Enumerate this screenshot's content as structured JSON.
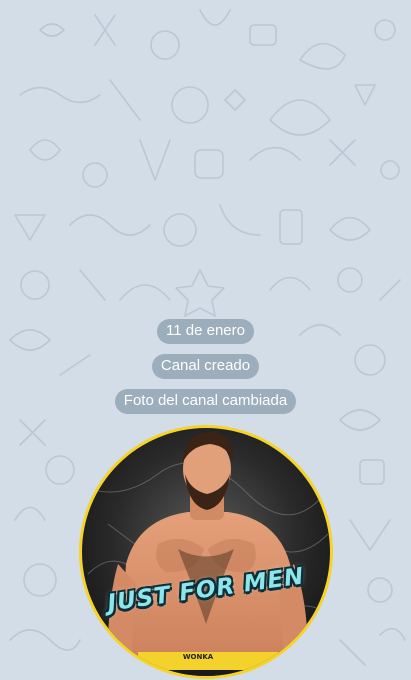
{
  "service_messages": [
    {
      "text": "11 de enero"
    },
    {
      "text": "Canal creado"
    },
    {
      "text": "Foto del canal cambiada"
    }
  ],
  "channel_photo": {
    "caption": "JUST FOR MEN",
    "waistband": "WONKA",
    "ring_color": "#f5d328"
  },
  "theme": {
    "background": "#d3dde8",
    "pill_color": "#708596",
    "doodle_color": "#b6c3d0"
  }
}
